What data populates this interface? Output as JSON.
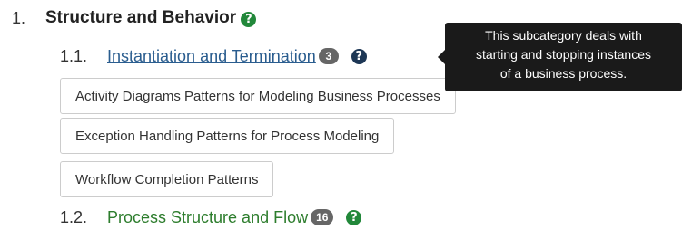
{
  "category": {
    "number": "1.",
    "title": "Structure and Behavior",
    "help_icon": "question-circle-icon"
  },
  "subcategories": [
    {
      "number": "1.1.",
      "title": "Instantiation and Termination",
      "count": "3",
      "help_icon": "question-circle-icon",
      "expanded": true,
      "patterns": [
        "Activity Diagrams Patterns for Modeling Business Processes",
        "Exception Handling Patterns for Process Modeling",
        "Workflow Completion Patterns"
      ]
    },
    {
      "number": "1.2.",
      "title": "Process Structure and Flow",
      "count": "16",
      "help_icon": "question-circle-icon",
      "expanded": false
    }
  ],
  "tooltip": {
    "lines": [
      "This subcategory deals with",
      "starting and stopping instances",
      "of a business process."
    ]
  },
  "colors": {
    "link_blue": "#2a5d8f",
    "link_green": "#2d7d2d",
    "help_green": "#22883a",
    "help_dark": "#1d3755",
    "badge_gray": "#666666",
    "tooltip_bg": "#1a1a1a"
  }
}
